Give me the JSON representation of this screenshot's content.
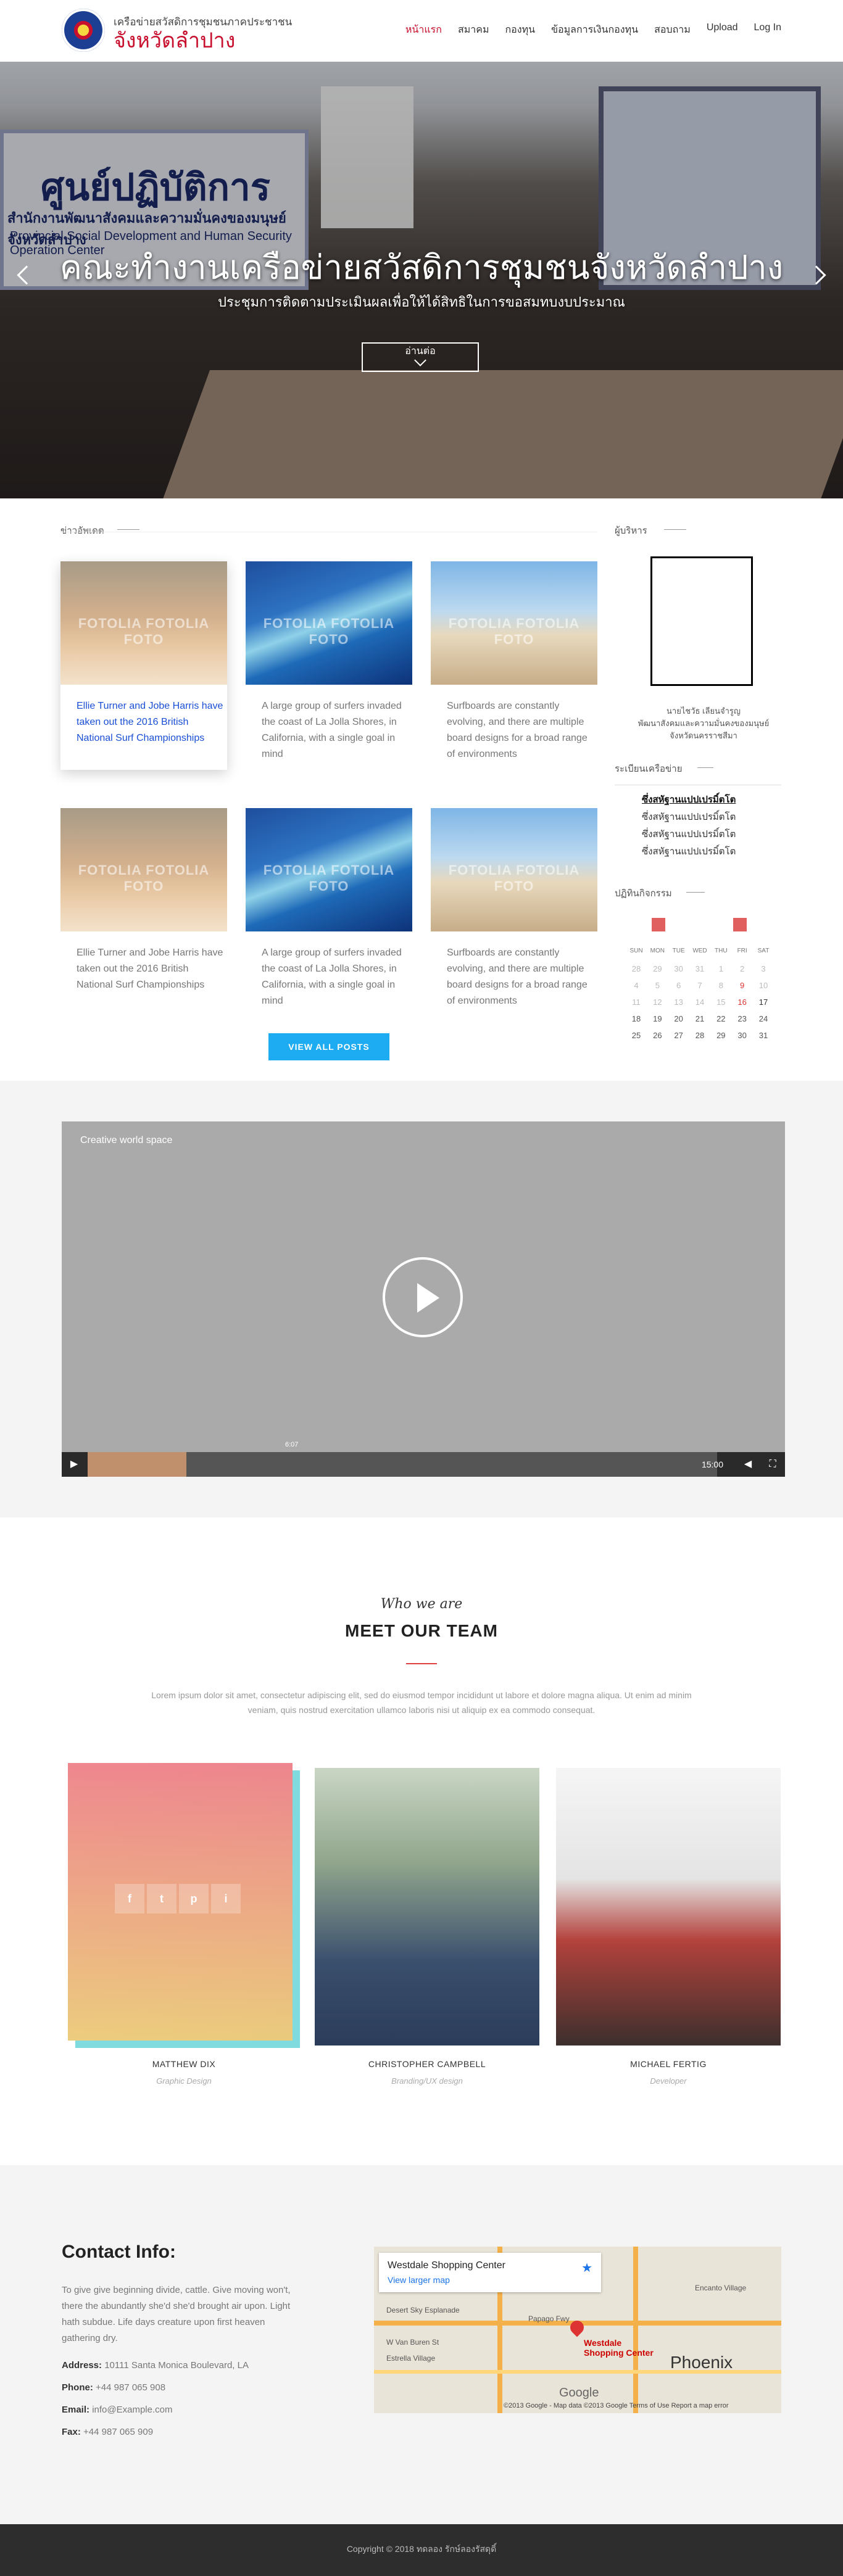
{
  "header": {
    "logo_line1": "เครือข่ายสวัสดิการชุมชนภาคประชาชน",
    "logo_line2": "จังหวัดลำปาง",
    "nav": [
      "หน้าแรก",
      "สมาคม",
      "กองทุน",
      "ข้อมูลการเงินกองทุน",
      "สอบถาม",
      "Upload",
      "Log In"
    ]
  },
  "hero": {
    "banner_title": "ศูนย์ปฏิบัติการ",
    "banner_sub1": "สำนักงานพัฒนาสังคมและความมั่นคงของมนุษย์จังหวัดลำปาง",
    "banner_sub2": "Provincial Social Development and Human Security Operation Center",
    "title": "คณะทำงานเครือข่ายสวัสดิการชุมชนจังหวัดลำปาง",
    "subtitle": "ประชุมการติดตามประเมินผลเพื่อให้ได้สิทธิในการขอสมทบงบประมาณ",
    "button": "อ่านต่อ"
  },
  "news": {
    "section_title": "ข่าวอัพเดต",
    "watermark": "FOTOLIA  FOTOLIA  FOTO",
    "posts": [
      "Ellie Turner and Jobe Harris have taken out the 2016 British National Surf Championships",
      "A large group of surfers invaded the coast of La Jolla Shores, in California, with a single goal in mind",
      "Surfboards are constantly evolving, and there are multiple board designs for a broad range of environments",
      "Ellie Turner and Jobe Harris have taken out the 2016 British National Surf Championships",
      "A large group of surfers invaded the coast of La Jolla Shores, in California, with a single goal in mind",
      "Surfboards are constantly evolving, and there are multiple board designs for a broad range of environments"
    ],
    "view_all": "VIEW ALL POSTS"
  },
  "sidebar": {
    "admin_title": "ผู้บริหาร",
    "admin_name": "นายไชวัธ เลียนจำรูญ",
    "admin_role1": "พัฒนาสังคมและความมั่นคงของมนุษย์",
    "admin_role2": "จังหวัดนครราชสีมา",
    "system_title": "ระเบียนเครือข่าย",
    "system_links": [
      "ซึ่งสหัฐานแปปเปรมิ์ตโต",
      "ซึ่งสหัฐานแปปเปรมิ์ตโต",
      "ซึ่งสหัฐานแปปเปรมิ์ตโต",
      "ซึ่งสหัฐานแปปเปรมิ์ตโต"
    ],
    "calendar_title": "ปฏิทินกิจกรรม",
    "calendar_days": [
      "SUN",
      "MON",
      "TUE",
      "WED",
      "THU",
      "FRI",
      "SAT"
    ],
    "calendar_weeks": [
      [
        "28",
        "29",
        "30",
        "31",
        "1",
        "2",
        "3"
      ],
      [
        "4",
        "5",
        "6",
        "7",
        "8",
        "9",
        "10"
      ],
      [
        "11",
        "12",
        "13",
        "14",
        "15",
        "16",
        "17"
      ],
      [
        "18",
        "19",
        "20",
        "21",
        "22",
        "23",
        "24"
      ],
      [
        "25",
        "26",
        "27",
        "28",
        "29",
        "30",
        "31"
      ]
    ]
  },
  "video": {
    "title": "Creative world space",
    "tooltip_time": "6:07",
    "duration": "15:00"
  },
  "team": {
    "subtitle": "Who we are",
    "title": "MEET OUR TEAM",
    "description": "Lorem ipsum dolor sit amet, consectetur adipiscing elit, sed do eiusmod tempor incididunt ut labore et dolore magna aliqua. Ut enim ad minim veniam, quis nostrud exercitation ullamco laboris nisi ut aliquip ex ea commodo consequat.",
    "social": [
      "f",
      "t",
      "p",
      "i"
    ],
    "members": [
      {
        "name": "MATTHEW DIX",
        "role": "Graphic Design"
      },
      {
        "name": "CHRISTOPHER CAMPBELL",
        "role": "Branding/UX design"
      },
      {
        "name": "MICHAEL FERTIG",
        "role": "Developer"
      }
    ]
  },
  "contact": {
    "title": "Contact Info:",
    "body": "To give give beginning divide, cattle. Give moving won't, there the abundantly she'd she'd brought air upon. Light hath subdue. Life days creature upon first heaven gathering dry.",
    "address_label": "Address:",
    "address": "10111 Santa Monica Boulevard, LA",
    "phone_label": "Phone:",
    "phone": "+44 987 065 908",
    "email_label": "Email:",
    "email": "info@Example.com",
    "fax_label": "Fax:",
    "fax": "+44 987 065 909"
  },
  "map": {
    "place": "Westdale Shopping Center",
    "link": "View larger map",
    "pin_label": "Westdale Shopping Center",
    "city": "Phoenix",
    "streets": [
      "Desert Sky Esplanade",
      "Papago Fwy",
      "Estrella Village",
      "W Van Buren St",
      "Encanto Village"
    ],
    "copyright": "©2013 Google - Map data ©2013 Google   Terms of Use   Report a map error",
    "google": "Google"
  },
  "footer": {
    "text": "Copyright © 2018 ทดลอง รักษ์ลองรัสดุดิ์"
  }
}
